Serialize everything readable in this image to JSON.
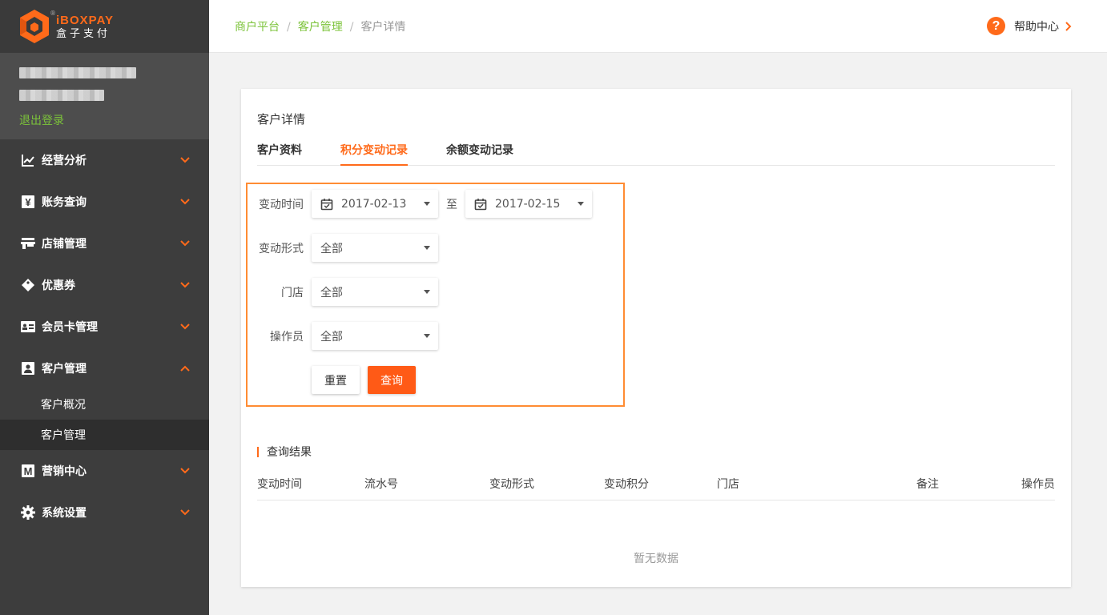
{
  "brand": {
    "name_en": "iBOXPAY",
    "name_cn": "盒子支付",
    "reg": "®"
  },
  "user": {
    "logout_label": "退出登录"
  },
  "menu": [
    {
      "label": "经营分析",
      "icon": "chart-line-icon"
    },
    {
      "label": "账务查询",
      "icon": "yen-icon"
    },
    {
      "label": "店铺管理",
      "icon": "store-icon"
    },
    {
      "label": "优惠券",
      "icon": "coupon-icon"
    },
    {
      "label": "会员卡管理",
      "icon": "member-card-icon"
    },
    {
      "label": "客户管理",
      "icon": "customer-icon",
      "expanded": true,
      "children": [
        {
          "label": "客户概况"
        },
        {
          "label": "客户管理",
          "active": true
        }
      ]
    },
    {
      "label": "营销中心",
      "icon": "marketing-icon"
    },
    {
      "label": "系统设置",
      "icon": "gear-icon"
    }
  ],
  "breadcrumb": {
    "items": [
      "商户平台",
      "客户管理",
      "客户详情"
    ],
    "separator": "/"
  },
  "help": {
    "icon_text": "?",
    "label": "帮助中心"
  },
  "card": {
    "title": "客户详情",
    "tabs": [
      {
        "label": "客户资料"
      },
      {
        "label": "积分变动记录",
        "active": true
      },
      {
        "label": "余额变动记录"
      }
    ]
  },
  "filter": {
    "time_label": "变动时间",
    "date_from": "2017-02-13",
    "to_text": "至",
    "date_to": "2017-02-15",
    "type_label": "变动形式",
    "type_value": "全部",
    "store_label": "门店",
    "store_value": "全部",
    "operator_label": "操作员",
    "operator_value": "全部",
    "reset_label": "重置",
    "query_label": "查询"
  },
  "results": {
    "title": "查询结果",
    "columns": [
      "变动时间",
      "流水号",
      "变动形式",
      "变动积分",
      "门店",
      "备注",
      "操作员"
    ],
    "empty_text": "暂无数据"
  },
  "colors": {
    "accent": "#ff6a1a",
    "link": "#7cc33a",
    "sidebar": "#3d3d3d",
    "filter_border": "#ff8c33"
  }
}
